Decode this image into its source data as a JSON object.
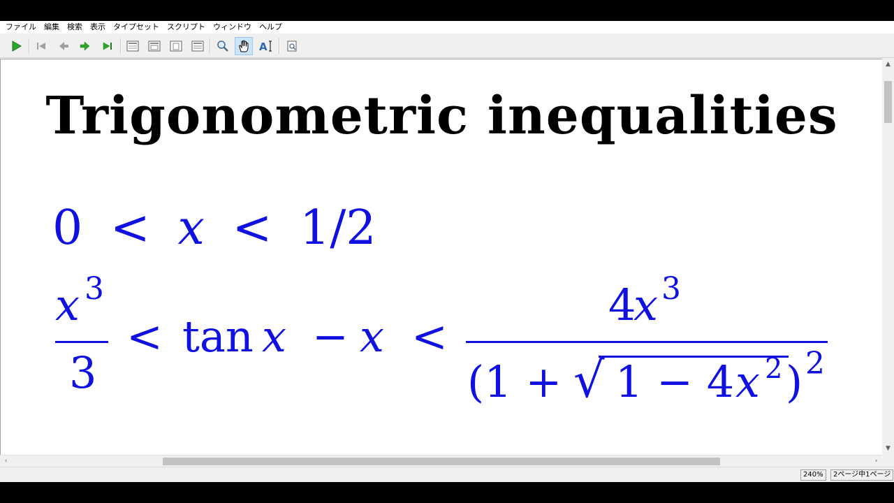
{
  "menu": [
    "ファイル",
    "編集",
    "検索",
    "表示",
    "タイプセット",
    "スクリプト",
    "ウィンドウ",
    "ヘルプ"
  ],
  "toolbar": {
    "icons": [
      "play-icon",
      "first-page-icon",
      "previous-page-icon",
      "next-page-icon",
      "last-page-icon",
      "single-page-icon",
      "facing-pages-icon",
      "fit-page-icon",
      "fit-width-icon",
      "magnifier-icon",
      "hand-tool-icon",
      "text-select-icon",
      "find-icon"
    ],
    "active_tool": "hand-tool-icon"
  },
  "document": {
    "title": "Trigonometric inequalities",
    "eq1": {
      "zero": "0",
      "lt1": "<",
      "x": "x",
      "lt2": "<",
      "half": "1/2"
    },
    "eq2": {
      "lhs_num_base": "x",
      "lhs_num_exp": "3",
      "lhs_den": "3",
      "lt1": "<",
      "tan": "tan",
      "x1": "x",
      "minus": "−",
      "x2": "x",
      "lt2": "<",
      "rhs_num_coef": "4",
      "rhs_num_base": "x",
      "rhs_num_exp": "3",
      "rhs_den_open": "(1 +",
      "rhs_den_sqrt": "√",
      "rhs_den_inner": "1 − 4",
      "rhs_den_x": "x",
      "rhs_den_inner_exp": "2",
      "rhs_den_close": ")",
      "rhs_den_outer_exp": "2"
    },
    "text_color": "#1010e0"
  },
  "status": {
    "zoom": "240%",
    "page_info": "2ページ中1ページ"
  }
}
